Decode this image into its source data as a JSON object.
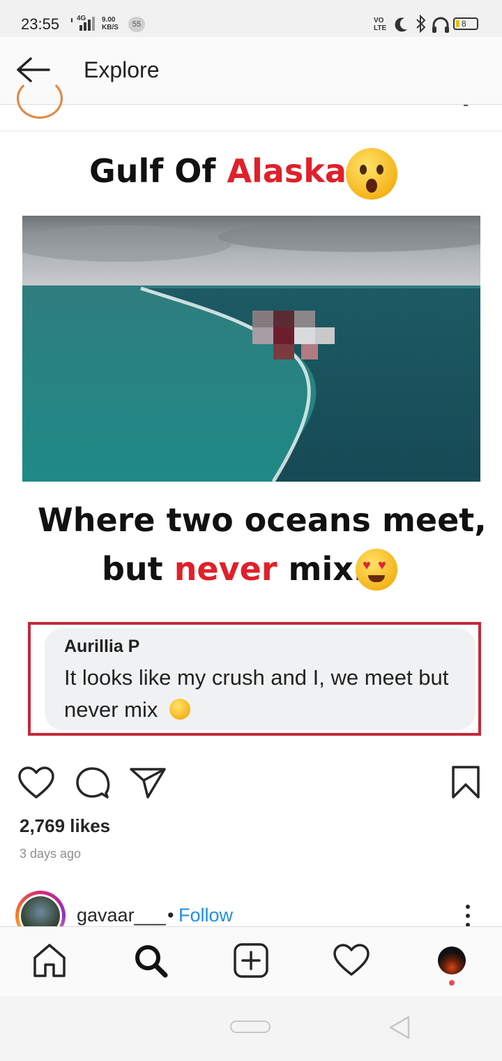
{
  "status_bar": {
    "time": "23:55",
    "network": "4G",
    "speed_value": "9.00",
    "speed_unit": "KB/S",
    "notification_count": "55",
    "volte": "VO\nLTE",
    "battery": "8"
  },
  "header": {
    "title": "Explore"
  },
  "post": {
    "image_title_prefix": "Gulf Of ",
    "image_title_highlight": "Alaska",
    "caption_line1": "Where two oceans meet,",
    "caption_line2_start": "but ",
    "caption_line2_highlight": "never",
    "caption_line2_end": " mix.",
    "comment_author": "Aurillia P",
    "comment_text": "It looks like my crush and I, we meet but never mix",
    "likes": "2,769 likes",
    "time_ago": "3 days ago"
  },
  "next_post": {
    "username": "gavaar___",
    "separator": "•",
    "follow_label": "Follow"
  },
  "icons": {
    "back": "arrow-left-icon",
    "like": "heart-icon",
    "comment": "comment-icon",
    "share": "send-icon",
    "save": "bookmark-icon",
    "more": "more-vertical-icon",
    "nav_home": "home-icon",
    "nav_search": "search-icon",
    "nav_add": "add-post-icon",
    "nav_activity": "heart-icon",
    "nav_profile": "profile-avatar"
  },
  "colors": {
    "accent_red": "#e0202a",
    "follow_blue": "#1e90e6",
    "comment_border": "#c32a3a"
  }
}
